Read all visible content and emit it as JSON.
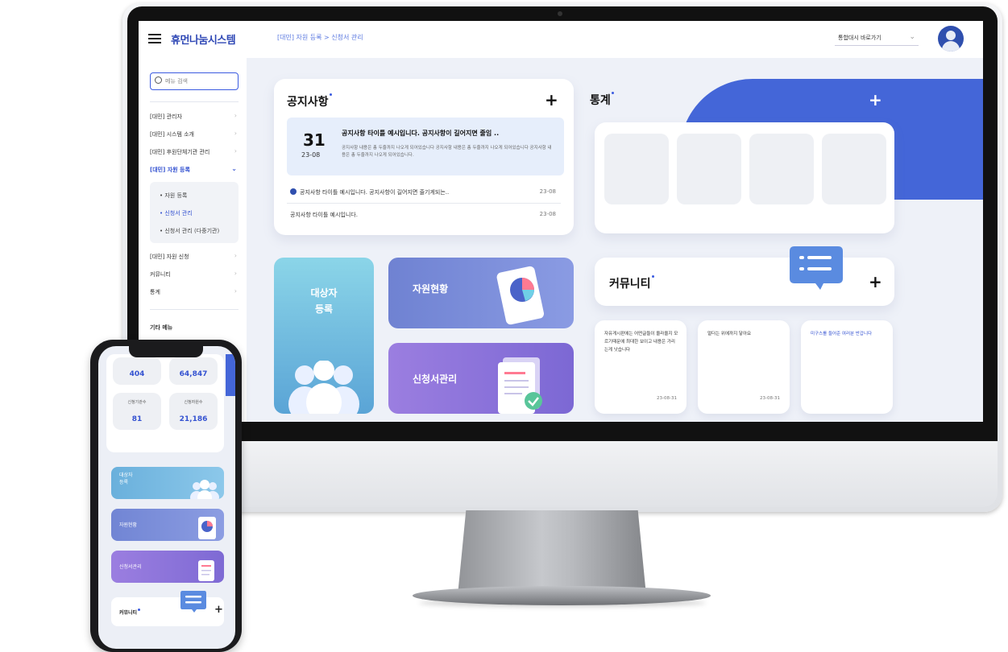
{
  "header": {
    "logo": "휴먼나눔시스템",
    "breadcrumb": "[대민] 자원 등록 > 신청서 관리",
    "org_select": "통합대시 바로가기"
  },
  "sidebar": {
    "search_placeholder": "메뉴 검색",
    "items_top": [
      "[대민] 관리자",
      "[대민] 시스템 소개",
      "[대민] 후원단체기관 관리",
      "[대민] 자원 등록"
    ],
    "sub_items": [
      "• 자원 등록",
      "• 신청서 관리",
      "• 신청서 관리 (다중기관)"
    ],
    "items_bottom": [
      "[대민] 자원 신청",
      "커뮤니티",
      "통계"
    ],
    "more_label": "기타 메뉴"
  },
  "notice": {
    "title": "공지사항",
    "highlight": {
      "day": "31",
      "year_month": "23-08",
      "title": "공지사항 타이틀 예시입니다. 공지사항이 길어지면 줄임 ..",
      "body": "공지사항 내용은 총 두줄까지 나오게 되어있습니다 공지사항 내용은 총 두줄까지 나오게 되어있습니다 공지사항 내용은 총 두줄까지 나오게 되어있습니다."
    },
    "rows": [
      {
        "text": "공지사항 타이틀 예시입니다. 공지사항이 길어지면 줄기게되는..",
        "date": "23-08"
      },
      {
        "text": "공지사항 타이틀 예시입니다.",
        "date": "23-08"
      }
    ]
  },
  "stats": {
    "title": "통계"
  },
  "tiles": {
    "target": "대상자\n등록",
    "resources": "자원현황",
    "apps": "신청서관리"
  },
  "community": {
    "title": "커뮤니티",
    "posts": [
      {
        "text": "자유게시판에는 어떤글들이 올라올지 모르기때문에 최대한 보이고 내용은 가리는게 낫습니다",
        "date": "23-08-31"
      },
      {
        "text": "멀더는 위에까지 닿아요",
        "date": "23-08-31"
      },
      {
        "text": "미구스를 들어준 여러분 반갑니다"
      }
    ]
  },
  "phone": {
    "stats": [
      {
        "value": "404"
      },
      {
        "value": "64,847"
      },
      {
        "label": "신청기관수",
        "value": "81"
      },
      {
        "label": "신청자원수",
        "value": "21,186"
      }
    ],
    "tiles": [
      "대상자\n등록",
      "자원현황",
      "신청서관리"
    ],
    "community_label": "커뮤니티"
  },
  "colors": {
    "accent": "#3b5be0",
    "brand": "#2f48b5",
    "stat_wave": "#4466d8"
  }
}
